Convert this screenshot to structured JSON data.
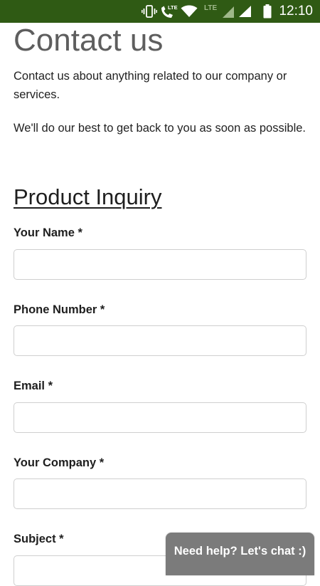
{
  "status_bar": {
    "time": "12:10",
    "background_color": "#2f5a14",
    "icons": [
      "vibrate-icon",
      "volte-call-icon",
      "wifi-icon",
      "lte-signal-icon",
      "signal-icon",
      "battery-icon"
    ],
    "lte_label": "LTE"
  },
  "page": {
    "title": "Contact us",
    "intro": "Contact us about anything related to our company or services.",
    "followup": "We'll do our best to get back to you as soon as possible."
  },
  "form": {
    "section_title": "Product Inquiry",
    "fields": [
      {
        "label": "Your Name *",
        "value": "",
        "placeholder": ""
      },
      {
        "label": "Phone Number *",
        "value": "",
        "placeholder": ""
      },
      {
        "label": "Email *",
        "value": "",
        "placeholder": ""
      },
      {
        "label": "Your Company *",
        "value": "",
        "placeholder": ""
      },
      {
        "label": "Subject *",
        "value": "",
        "placeholder": ""
      }
    ]
  },
  "chat": {
    "label": "Need help? Let's chat :)",
    "background_color": "#7b7b7b"
  }
}
